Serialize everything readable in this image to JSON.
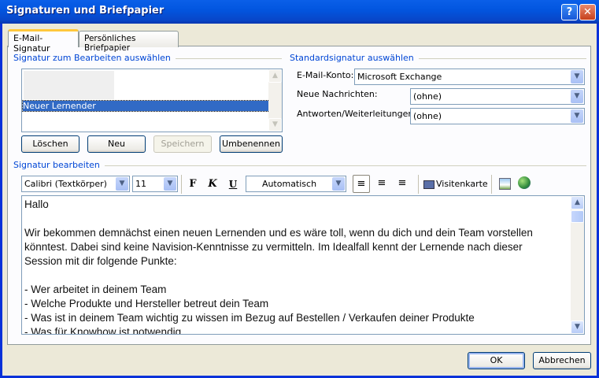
{
  "window": {
    "title": "Signaturen und Briefpapier",
    "help": "?",
    "close": "✕"
  },
  "tabs": [
    {
      "label": "E-Mail-Signatur"
    },
    {
      "label": "Persönliches Briefpapier"
    }
  ],
  "select_section": {
    "title": "Signatur zum Bearbeiten auswählen",
    "items": [
      "Neuer Lernender"
    ],
    "buttons": {
      "delete": "Löschen",
      "new": "Neu",
      "save": "Speichern",
      "rename": "Umbenennen"
    }
  },
  "default_section": {
    "title": "Standardsignatur auswählen",
    "account_label": "E-Mail-Konto:",
    "account_value": "Microsoft Exchange",
    "new_label": "Neue Nachrichten:",
    "new_value": "(ohne)",
    "reply_label": "Antworten/Weiterleitungen:",
    "reply_value": "(ohne)"
  },
  "edit_section": {
    "title": "Signatur bearbeiten",
    "font": "Calibri (Textkörper)",
    "size": "11",
    "bold": "F",
    "italic": "K",
    "underline": "U",
    "color": "Automatisch",
    "business_card": "Visitenkarte"
  },
  "editor_lines": [
    "Hallo",
    "",
    "Wir bekommen demnächst einen neuen Lernenden und es wäre toll, wenn du dich und dein Team vorstellen",
    "könntest. Dabei sind keine Navision-Kenntnisse zu vermitteln. Im Idealfall kennt der Lernende nach dieser",
    "Session mit dir folgende Punkte:",
    "",
    "  - Wer arbeitet in deinem Team",
    "  - Welche Produkte und Hersteller betreut dein Team",
    "  - Was ist in deinem Team wichtig zu wissen im Bezug auf Bestellen / Verkaufen deiner Produkte",
    "  - Was für Knowhow ist notwendig"
  ],
  "footer": {
    "ok": "OK",
    "cancel": "Abbrechen"
  }
}
